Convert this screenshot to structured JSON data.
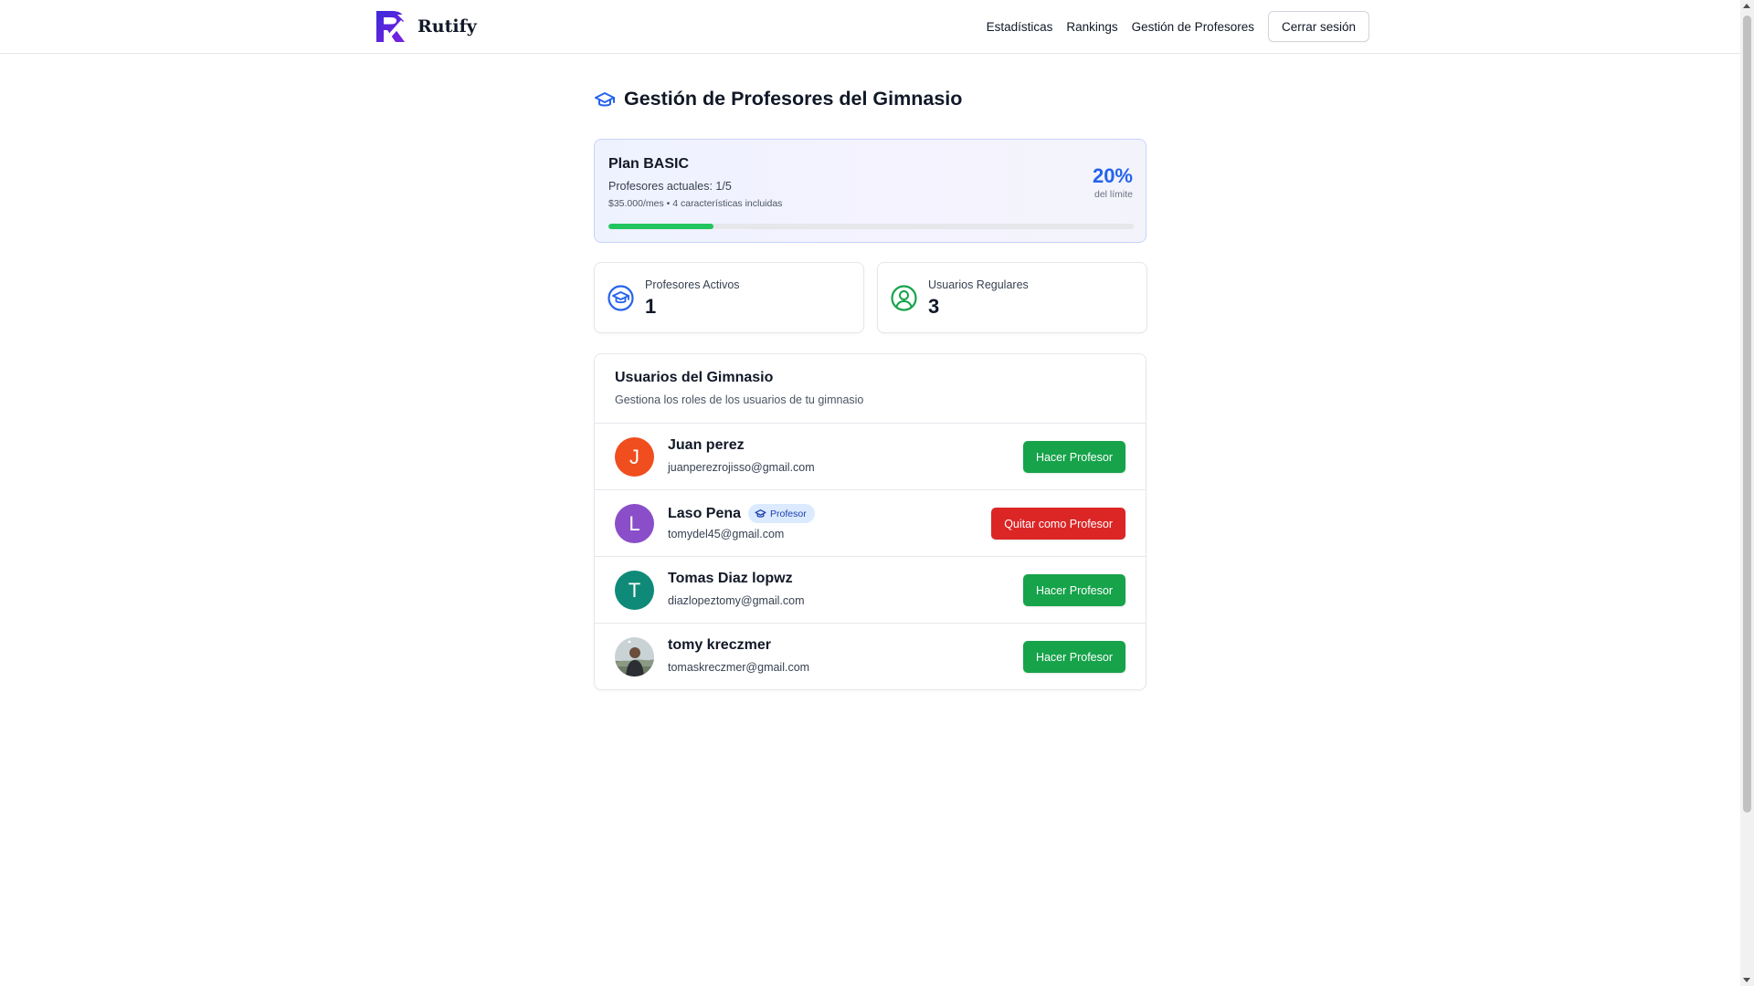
{
  "brand": {
    "name": "Rutify",
    "logo_icon": "rutify-r-logo-icon"
  },
  "nav": {
    "links": [
      "Estadísticas",
      "Rankings",
      "Gestión de Profesores"
    ],
    "logout_label": "Cerrar sesión"
  },
  "page": {
    "title": "Gestión de Profesores del Gimnasio",
    "title_icon": "graduation-cap-icon"
  },
  "plan": {
    "name": "Plan BASIC",
    "count": "Profesores actuales: 1/5",
    "price": "$35.000/mes • 4 características incluidas",
    "percent": "20%",
    "limit_label": "del límite",
    "usage_fraction": 0.2
  },
  "stats": {
    "teachers": {
      "label": "Profesores Activos",
      "value": "1",
      "icon": "graduation-cap-circle-icon"
    },
    "regular": {
      "label": "Usuarios Regulares",
      "value": "3",
      "icon": "user-circle-icon"
    }
  },
  "users": {
    "title": "Usuarios del Gimnasio",
    "subtitle": "Gestiona los roles de los usuarios de tu gimnasio",
    "badge_label": "Profesor",
    "rows": [
      {
        "name": "Juan perez",
        "email": "juanperezrojisso@gmail.com",
        "initial": "J",
        "avatar_color": "#f04e1f",
        "is_teacher": false,
        "action": "Hacer Profesor"
      },
      {
        "name": "Laso Pena",
        "email": "tomydel45@gmail.com",
        "initial": "L",
        "avatar_color": "#8a4fc8",
        "is_teacher": true,
        "action": "Quitar como Profesor"
      },
      {
        "name": "Tomas Diaz lopwz",
        "email": "diazlopeztomy@gmail.com",
        "initial": "T",
        "avatar_color": "#0f8a78",
        "is_teacher": false,
        "action": "Hacer Profesor"
      },
      {
        "name": "tomy kreczmer",
        "email": "tomaskreczmer@gmail.com",
        "initial": "",
        "avatar_color": "#6b7c84",
        "is_teacher": false,
        "action": "Hacer Profesor"
      }
    ]
  },
  "colors": {
    "accent_blue": "#2563eb",
    "success_green": "#16a34a",
    "danger_red": "#dc2626",
    "progress_green": "#22c55e"
  }
}
